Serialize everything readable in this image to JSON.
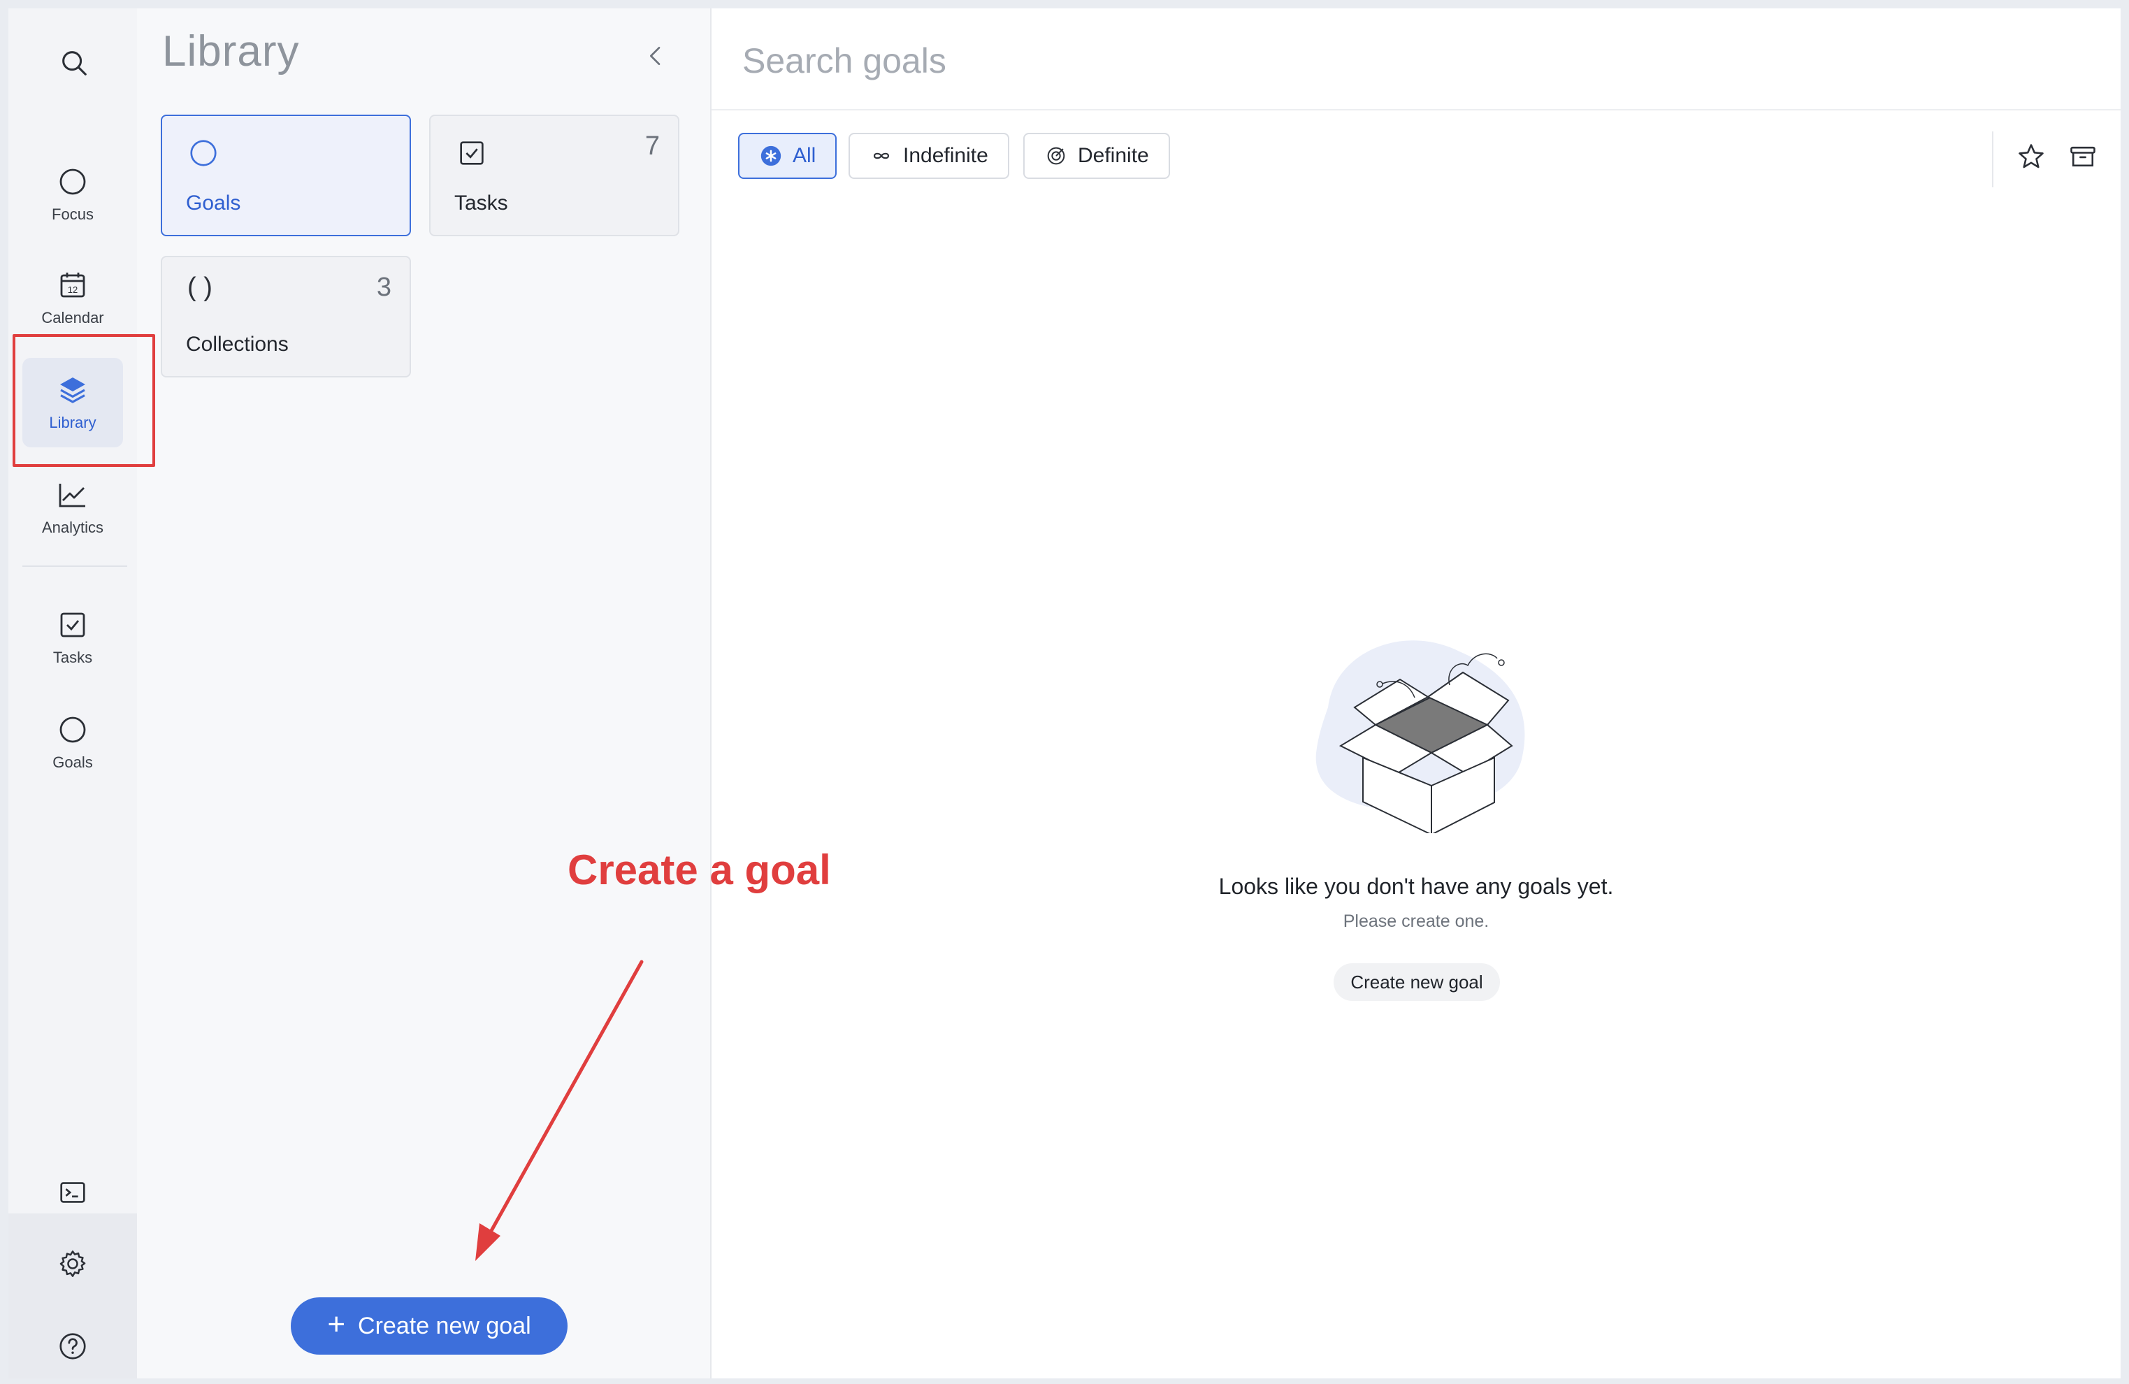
{
  "rail": {
    "search": {
      "icon": "search-icon"
    },
    "items": [
      {
        "label": "Focus",
        "icon": "circle-icon"
      },
      {
        "label": "Calendar",
        "icon": "calendar-icon",
        "day": "12"
      },
      {
        "label": "Library",
        "icon": "layers-icon",
        "active": true
      },
      {
        "label": "Analytics",
        "icon": "chart-line-icon"
      },
      {
        "label": "Tasks",
        "icon": "checkbox-icon"
      },
      {
        "label": "Goals",
        "icon": "circle-icon"
      }
    ],
    "terminal": {
      "icon": "terminal-icon"
    },
    "settings": {
      "icon": "gear-icon"
    },
    "help": {
      "icon": "help-icon"
    }
  },
  "library": {
    "title": "Library",
    "cards": [
      {
        "label": "Goals",
        "count": "",
        "selected": true
      },
      {
        "label": "Tasks",
        "count": "7"
      },
      {
        "label": "Collections",
        "count": "3",
        "glyph": "( )"
      }
    ],
    "create_button": "Create new goal"
  },
  "main": {
    "search_placeholder": "Search goals",
    "filters": [
      {
        "label": "All",
        "active": true
      },
      {
        "label": "Indefinite"
      },
      {
        "label": "Definite"
      }
    ],
    "empty": {
      "title": "Looks like you don't have any goals yet.",
      "subtitle": "Please create one.",
      "button": "Create new goal"
    }
  },
  "annotation": {
    "text": "Create a goal"
  },
  "colors": {
    "accent": "#3d6fdb",
    "annotation": "#e03e3e",
    "rail_bg": "#f3f4f7",
    "panel_bg": "#f7f8fa"
  }
}
